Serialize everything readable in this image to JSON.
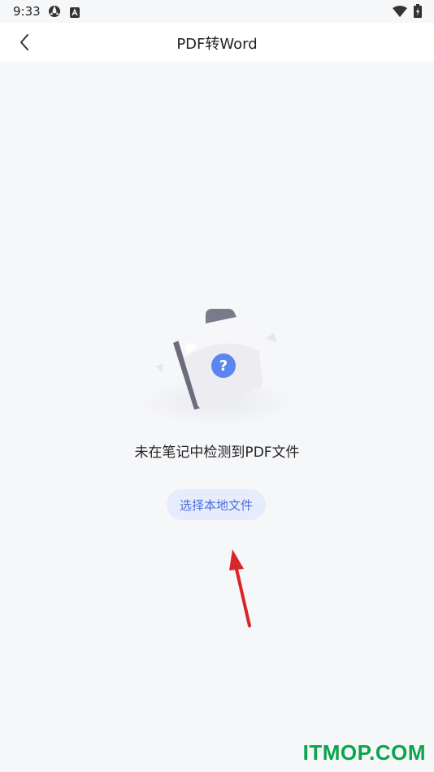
{
  "status_bar": {
    "time": "9:33",
    "icons": [
      "sync-icon",
      "a-badge-icon",
      "wifi-icon",
      "battery-charging-icon"
    ]
  },
  "app_bar": {
    "title": "PDF转Word",
    "back_icon": "chevron-left-icon"
  },
  "empty_state": {
    "illustration_icon": "folder-question-icon",
    "message": "未在笔记中检测到PDF文件",
    "button_label": "选择本地文件"
  },
  "annotation": {
    "arrow_color": "#d9252a"
  },
  "watermark": {
    "text": "ITMOP.COM",
    "color": "#0aa54a"
  },
  "colors": {
    "background": "#f6f7f9",
    "accent": "#4a6ee0",
    "button_bg": "#e7ecfb"
  }
}
